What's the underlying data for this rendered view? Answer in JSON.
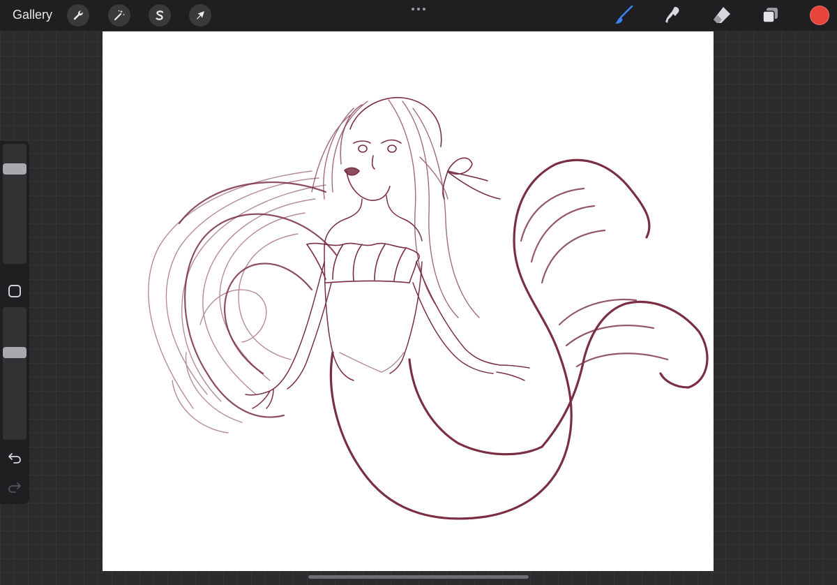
{
  "topbar": {
    "gallery_label": "Gallery",
    "left_tools": [
      {
        "icon": "wrench-icon",
        "name": "actions"
      },
      {
        "icon": "magic-wand-icon",
        "name": "adjustments"
      },
      {
        "icon": "selection-s-icon",
        "name": "selection"
      },
      {
        "icon": "arrow-cursor-icon",
        "name": "transform"
      }
    ],
    "more_icon": "ellipsis-icon",
    "right_tools": [
      {
        "icon": "brush-icon",
        "name": "paint",
        "active": true
      },
      {
        "icon": "smudge-icon",
        "name": "smudge",
        "active": false
      },
      {
        "icon": "eraser-icon",
        "name": "erase",
        "active": false
      },
      {
        "icon": "layers-icon",
        "name": "layers",
        "active": false
      }
    ],
    "current_color": "#e7453a"
  },
  "sidebar": {
    "brush_size_level": 0.82,
    "opacity_level": 0.67,
    "modify_icon": "square-icon",
    "undo_icon": "undo-icon",
    "redo_icon": "redo-icon"
  },
  "canvas": {
    "background": "#ffffff",
    "stroke_color": "#7a2e42",
    "content": "mermaid-sketch"
  }
}
